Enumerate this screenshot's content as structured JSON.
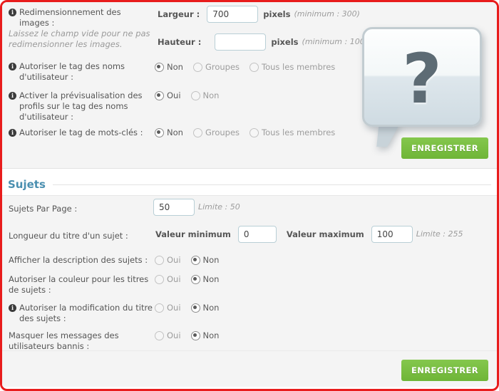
{
  "theme": {
    "border_color": "#e81c1c",
    "accent_heading": "#4a8fb0",
    "button_green": "#7ac143",
    "panel_bg": "#f4f4f4"
  },
  "images_section": {
    "resize": {
      "label": "Redimensionnement des images :",
      "note": "Laissez le champ vide pour ne pas redimensionner les images.",
      "width_label": "Largeur :",
      "width_value": "700",
      "width_unit": "pixels",
      "width_hint": "(minimum : 300)",
      "height_label": "Hauteur :",
      "height_value": "",
      "height_unit": "pixels",
      "height_hint": "(minimum : 100)"
    },
    "username_tag": {
      "label": "Autoriser le tag des noms d'utilisateur :",
      "options": [
        "Non",
        "Groupes",
        "Tous les membres"
      ],
      "selected": "Non"
    },
    "profile_preview": {
      "label": "Activer la prévisualisation des profils sur le tag des noms d'utilisateur :",
      "options": [
        "Oui",
        "Non"
      ],
      "selected": "Oui"
    },
    "keyword_tag": {
      "label": "Autoriser le tag de mots-clés :",
      "options": [
        "Non",
        "Groupes",
        "Tous les membres"
      ],
      "selected": "Non"
    },
    "help_icon": "question-speech-bubble-icon",
    "help_glyph": "?",
    "save_label": "ENREGISTRER"
  },
  "sujets_section": {
    "title": "Sujets",
    "per_page": {
      "label": "Sujets Par Page :",
      "value": "50",
      "hint": "Limite : 50"
    },
    "title_length": {
      "label": "Longueur du titre d'un sujet :",
      "min_label": "Valeur minimum",
      "min_value": "0",
      "max_label": "Valeur maximum",
      "max_value": "100",
      "hint": "Limite : 255"
    },
    "show_description": {
      "label": "Afficher la description des sujets :",
      "options": [
        "Oui",
        "Non"
      ],
      "selected": "Non"
    },
    "allow_color": {
      "label": "Autoriser la couleur pour les titres de sujets :",
      "options": [
        "Oui",
        "Non"
      ],
      "selected": "Non"
    },
    "allow_title_edit": {
      "label": "Autoriser la modification du titre des sujets :",
      "options": [
        "Oui",
        "Non"
      ],
      "selected": "Non"
    },
    "hide_banned": {
      "label": "Masquer les messages des utilisateurs bannis :",
      "options": [
        "Oui",
        "Non"
      ],
      "selected": "Non"
    },
    "save_label": "ENREGISTRER"
  }
}
